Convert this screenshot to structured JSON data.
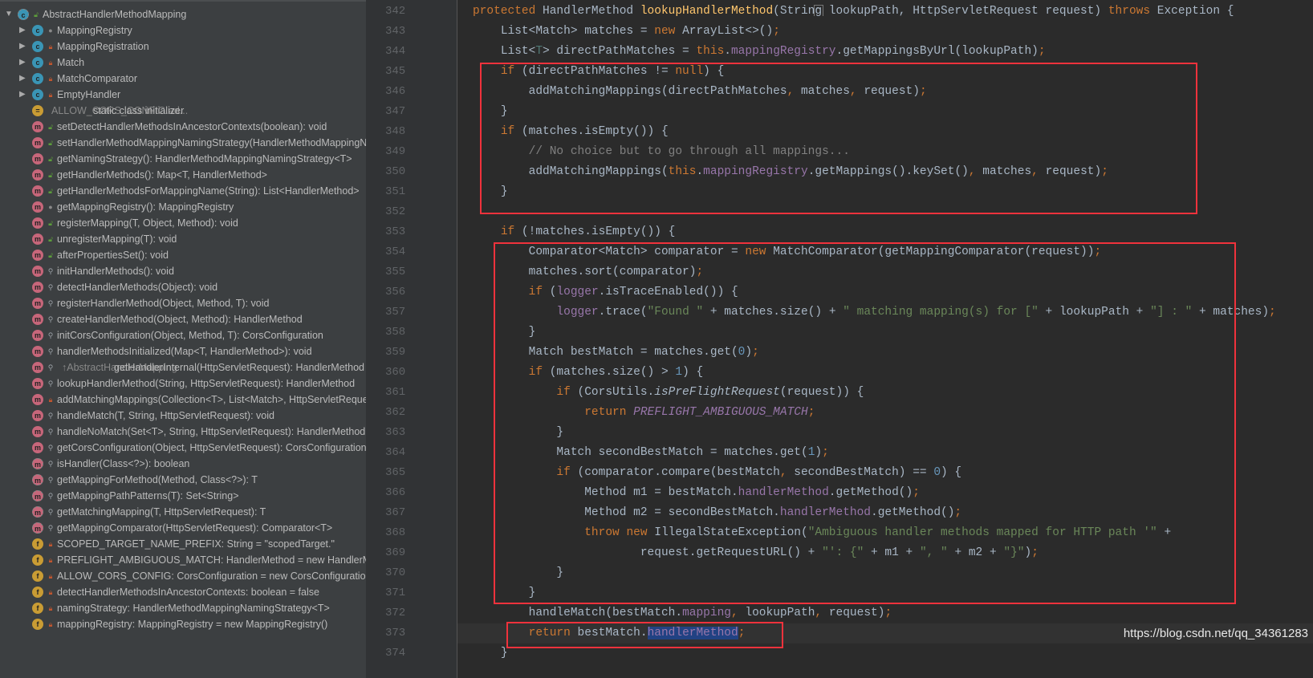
{
  "structure": {
    "items": [
      {
        "label": "AbstractHandlerMethodMapping",
        "icon": "c",
        "abstract": true,
        "vis": "public",
        "level": 0,
        "arrow": "expanded"
      },
      {
        "label": "MappingRegistry",
        "icon": "c",
        "vis": "package",
        "level": 1,
        "arrow": "collapsed"
      },
      {
        "label": "MappingRegistration",
        "icon": "c",
        "vis": "private",
        "level": 1,
        "arrow": "collapsed"
      },
      {
        "label": "Match",
        "icon": "c",
        "vis": "private",
        "level": 1,
        "arrow": "collapsed"
      },
      {
        "label": "MatchComparator",
        "icon": "c",
        "vis": "private",
        "level": 1,
        "arrow": "collapsed"
      },
      {
        "label": "EmptyHandler",
        "icon": "c",
        "vis": "private",
        "level": 1,
        "arrow": "collapsed"
      },
      {
        "label": "static class initializer",
        "hint": "ALLOW_CORS_CONFIG.ad...",
        "icon": "s",
        "vis": "",
        "level": 1
      },
      {
        "label": "setDetectHandlerMethodsInAncestorContexts(boolean): void",
        "icon": "m",
        "vis": "public",
        "level": 1
      },
      {
        "label": "setHandlerMethodMappingNamingStrategy(HandlerMethodMappingNamingStrategy<T>): void",
        "icon": "m",
        "vis": "public",
        "level": 1
      },
      {
        "label": "getNamingStrategy(): HandlerMethodMappingNamingStrategy<T>",
        "icon": "m",
        "vis": "public",
        "level": 1
      },
      {
        "label": "getHandlerMethods(): Map<T, HandlerMethod>",
        "icon": "m",
        "vis": "public",
        "level": 1
      },
      {
        "label": "getHandlerMethodsForMappingName(String): List<HandlerMethod>",
        "icon": "m",
        "vis": "public",
        "level": 1
      },
      {
        "label": "getMappingRegistry(): MappingRegistry",
        "icon": "m",
        "vis": "package",
        "level": 1
      },
      {
        "label": "registerMapping(T, Object, Method): void",
        "icon": "m",
        "vis": "public",
        "level": 1
      },
      {
        "label": "unregisterMapping(T): void",
        "icon": "m",
        "vis": "public",
        "level": 1
      },
      {
        "label": "afterPropertiesSet(): void",
        "icon": "m",
        "vis": "public",
        "level": 1
      },
      {
        "label": "initHandlerMethods(): void",
        "icon": "m",
        "vis": "protected",
        "level": 1
      },
      {
        "label": "detectHandlerMethods(Object): void",
        "icon": "m",
        "vis": "protected",
        "level": 1
      },
      {
        "label": "registerHandlerMethod(Object, Method, T): void",
        "icon": "m",
        "vis": "protected",
        "level": 1
      },
      {
        "label": "createHandlerMethod(Object, Method): HandlerMethod",
        "icon": "m",
        "vis": "protected",
        "level": 1
      },
      {
        "label": "initCorsConfiguration(Object, Method, T): CorsConfiguration",
        "icon": "m",
        "vis": "protected",
        "level": 1
      },
      {
        "label": "handlerMethodsInitialized(Map<T, HandlerMethod>): void",
        "icon": "m",
        "vis": "protected",
        "level": 1
      },
      {
        "label": "getHandlerInternal(HttpServletRequest): HandlerMethod",
        "hint": "↑AbstractHandlerMapping",
        "icon": "m",
        "vis": "protected",
        "level": 1
      },
      {
        "label": "lookupHandlerMethod(String, HttpServletRequest): HandlerMethod",
        "icon": "m",
        "vis": "protected",
        "level": 1
      },
      {
        "label": "addMatchingMappings(Collection<T>, List<Match>, HttpServletRequest): void",
        "icon": "m",
        "vis": "private",
        "level": 1
      },
      {
        "label": "handleMatch(T, String, HttpServletRequest): void",
        "icon": "m",
        "vis": "protected",
        "level": 1
      },
      {
        "label": "handleNoMatch(Set<T>, String, HttpServletRequest): HandlerMethod",
        "icon": "m",
        "vis": "protected",
        "level": 1
      },
      {
        "label": "getCorsConfiguration(Object, HttpServletRequest): CorsConfiguration",
        "icon": "m",
        "vis": "protected",
        "level": 1
      },
      {
        "label": "isHandler(Class<?>): boolean",
        "icon": "m",
        "abstract": true,
        "vis": "protected",
        "level": 1
      },
      {
        "label": "getMappingForMethod(Method, Class<?>): T",
        "icon": "m",
        "abstract": true,
        "vis": "protected",
        "level": 1
      },
      {
        "label": "getMappingPathPatterns(T): Set<String>",
        "icon": "m",
        "abstract": true,
        "vis": "protected",
        "level": 1
      },
      {
        "label": "getMatchingMapping(T, HttpServletRequest): T",
        "icon": "m",
        "abstract": true,
        "vis": "protected",
        "level": 1
      },
      {
        "label": "getMappingComparator(HttpServletRequest): Comparator<T>",
        "icon": "m",
        "abstract": true,
        "vis": "protected",
        "level": 1
      },
      {
        "label": "SCOPED_TARGET_NAME_PREFIX: String = \"scopedTarget.\"",
        "icon": "f",
        "vis": "private",
        "level": 1
      },
      {
        "label": "PREFLIGHT_AMBIGUOUS_MATCH: HandlerMethod = new HandlerMethod(...)",
        "icon": "f",
        "vis": "private",
        "level": 1
      },
      {
        "label": "ALLOW_CORS_CONFIG: CorsConfiguration = new CorsConfiguration()",
        "icon": "f",
        "vis": "private",
        "level": 1
      },
      {
        "label": "detectHandlerMethodsInAncestorContexts: boolean = false",
        "icon": "f",
        "vis": "private",
        "level": 1
      },
      {
        "label": "namingStrategy: HandlerMethodMappingNamingStrategy<T>",
        "icon": "f",
        "vis": "private",
        "level": 1
      },
      {
        "label": "mappingRegistry: MappingRegistry = new MappingRegistry()",
        "icon": "f",
        "vis": "private",
        "level": 1
      }
    ]
  },
  "editor": {
    "lines": [
      {
        "n": "342",
        "i": 0,
        "t": [
          [
            "k",
            "protected "
          ],
          [
            "p",
            "HandlerMethod "
          ],
          [
            "md",
            "lookupHandlerMethod"
          ],
          [
            "p",
            "(String lookupPath, HttpServletRequest request) "
          ],
          [
            "k",
            "throws "
          ],
          [
            "p",
            "Exception {"
          ]
        ]
      },
      {
        "n": "343",
        "i": 1,
        "t": [
          [
            "p",
            "List<Match> matches = "
          ],
          [
            "k",
            "new "
          ],
          [
            "p",
            "ArrayList<>()"
          ],
          [
            "k",
            ";"
          ]
        ]
      },
      {
        "n": "344",
        "i": 1,
        "t": [
          [
            "p",
            "List<"
          ],
          [
            "tp",
            "T"
          ],
          [
            "p",
            "> directPathMatches = "
          ],
          [
            "k",
            "this"
          ],
          [
            "p",
            "."
          ],
          [
            "fd",
            "mappingRegistry"
          ],
          [
            "p",
            ".getMappingsByUrl(lookupPath)"
          ],
          [
            "k",
            ";"
          ]
        ]
      },
      {
        "n": "345",
        "i": 1,
        "t": [
          [
            "k",
            "if "
          ],
          [
            "p",
            "(directPathMatches != "
          ],
          [
            "k",
            "null"
          ],
          [
            "p",
            ") {"
          ]
        ]
      },
      {
        "n": "346",
        "i": 2,
        "t": [
          [
            "p",
            "addMatchingMappings(directPathMatches"
          ],
          [
            "k",
            ", "
          ],
          [
            "p",
            "matches"
          ],
          [
            "k",
            ", "
          ],
          [
            "p",
            "request)"
          ],
          [
            "k",
            ";"
          ]
        ]
      },
      {
        "n": "347",
        "i": 1,
        "t": [
          [
            "p",
            "}"
          ]
        ]
      },
      {
        "n": "348",
        "i": 1,
        "t": [
          [
            "k",
            "if "
          ],
          [
            "p",
            "(matches.isEmpty()) {"
          ]
        ]
      },
      {
        "n": "349",
        "i": 2,
        "t": [
          [
            "cm",
            "// No choice but to go through all mappings..."
          ]
        ]
      },
      {
        "n": "350",
        "i": 2,
        "t": [
          [
            "p",
            "addMatchingMappings("
          ],
          [
            "k",
            "this"
          ],
          [
            "p",
            "."
          ],
          [
            "fd",
            "mappingRegistry"
          ],
          [
            "p",
            ".getMappings().keySet()"
          ],
          [
            "k",
            ", "
          ],
          [
            "p",
            "matches"
          ],
          [
            "k",
            ", "
          ],
          [
            "p",
            "request)"
          ],
          [
            "k",
            ";"
          ]
        ]
      },
      {
        "n": "351",
        "i": 1,
        "t": [
          [
            "p",
            "}"
          ]
        ]
      },
      {
        "n": "352",
        "i": 0,
        "t": []
      },
      {
        "n": "353",
        "i": 1,
        "t": [
          [
            "k",
            "if "
          ],
          [
            "p",
            "(!matches.isEmpty()) {"
          ]
        ]
      },
      {
        "n": "354",
        "i": 2,
        "t": [
          [
            "p",
            "Comparator<Match> comparator = "
          ],
          [
            "k",
            "new "
          ],
          [
            "p",
            "MatchComparator(getMappingComparator(request))"
          ],
          [
            "k",
            ";"
          ]
        ]
      },
      {
        "n": "355",
        "i": 2,
        "t": [
          [
            "p",
            "matches.sort(comparator)"
          ],
          [
            "k",
            ";"
          ]
        ]
      },
      {
        "n": "356",
        "i": 2,
        "t": [
          [
            "k",
            "if "
          ],
          [
            "p",
            "("
          ],
          [
            "fd",
            "logger"
          ],
          [
            "p",
            ".isTraceEnabled()) {"
          ]
        ]
      },
      {
        "n": "357",
        "i": 3,
        "t": [
          [
            "fd",
            "logger"
          ],
          [
            "p",
            ".trace("
          ],
          [
            "st",
            "\"Found \""
          ],
          [
            "p",
            " + matches.size() + "
          ],
          [
            "st",
            "\" matching mapping(s) for [\""
          ],
          [
            "p",
            " + lookupPath + "
          ],
          [
            "st",
            "\"] : \""
          ],
          [
            "p",
            " + matches)"
          ],
          [
            "k",
            ";"
          ]
        ]
      },
      {
        "n": "358",
        "i": 2,
        "t": [
          [
            "p",
            "}"
          ]
        ]
      },
      {
        "n": "359",
        "i": 2,
        "t": [
          [
            "p",
            "Match bestMatch = matches.get("
          ],
          [
            "nu",
            "0"
          ],
          [
            "p",
            ")"
          ],
          [
            "k",
            ";"
          ]
        ]
      },
      {
        "n": "360",
        "i": 2,
        "t": [
          [
            "k",
            "if "
          ],
          [
            "p",
            "(matches.size() > "
          ],
          [
            "nu",
            "1"
          ],
          [
            "p",
            ") {"
          ]
        ]
      },
      {
        "n": "361",
        "i": 3,
        "t": [
          [
            "k",
            "if "
          ],
          [
            "p",
            "(CorsUtils."
          ],
          [
            "sf",
            "isPreFlightRequest"
          ],
          [
            "p",
            "(request)) {"
          ]
        ]
      },
      {
        "n": "362",
        "i": 4,
        "t": [
          [
            "k",
            "return "
          ],
          [
            "it",
            "PREFLIGHT_AMBIGUOUS_MATCH"
          ],
          [
            "k",
            ";"
          ]
        ]
      },
      {
        "n": "363",
        "i": 3,
        "t": [
          [
            "p",
            "}"
          ]
        ]
      },
      {
        "n": "364",
        "i": 3,
        "t": [
          [
            "p",
            "Match secondBestMatch = matches.get("
          ],
          [
            "nu",
            "1"
          ],
          [
            "p",
            ")"
          ],
          [
            "k",
            ";"
          ]
        ]
      },
      {
        "n": "365",
        "i": 3,
        "t": [
          [
            "k",
            "if "
          ],
          [
            "p",
            "(comparator.compare(bestMatch"
          ],
          [
            "k",
            ", "
          ],
          [
            "p",
            "secondBestMatch) == "
          ],
          [
            "nu",
            "0"
          ],
          [
            "p",
            ") {"
          ]
        ]
      },
      {
        "n": "366",
        "i": 4,
        "t": [
          [
            "p",
            "Method m1 = bestMatch."
          ],
          [
            "fd",
            "handlerMethod"
          ],
          [
            "p",
            ".getMethod()"
          ],
          [
            "k",
            ";"
          ]
        ]
      },
      {
        "n": "367",
        "i": 4,
        "t": [
          [
            "p",
            "Method m2 = secondBestMatch."
          ],
          [
            "fd",
            "handlerMethod"
          ],
          [
            "p",
            ".getMethod()"
          ],
          [
            "k",
            ";"
          ]
        ]
      },
      {
        "n": "368",
        "i": 4,
        "t": [
          [
            "k",
            "throw new "
          ],
          [
            "p",
            "IllegalStateException("
          ],
          [
            "st",
            "\"Ambiguous handler methods mapped for HTTP path '\""
          ],
          [
            "p",
            " +"
          ]
        ]
      },
      {
        "n": "369",
        "i": 6,
        "t": [
          [
            "p",
            "request.getRequestURL() + "
          ],
          [
            "st",
            "\"': {\""
          ],
          [
            "p",
            " + m1 + "
          ],
          [
            "st",
            "\", \""
          ],
          [
            "p",
            " + m2 + "
          ],
          [
            "st",
            "\"}\""
          ],
          [
            "p",
            ")"
          ],
          [
            "k",
            ";"
          ]
        ]
      },
      {
        "n": "370",
        "i": 3,
        "t": [
          [
            "p",
            "}"
          ]
        ]
      },
      {
        "n": "371",
        "i": 2,
        "t": [
          [
            "p",
            "}"
          ]
        ]
      },
      {
        "n": "372",
        "i": 2,
        "t": [
          [
            "p",
            "handleMatch(bestMatch."
          ],
          [
            "fd",
            "mapping"
          ],
          [
            "k",
            ", "
          ],
          [
            "p",
            "lookupPath"
          ],
          [
            "k",
            ", "
          ],
          [
            "p",
            "request)"
          ],
          [
            "k",
            ";"
          ]
        ]
      },
      {
        "n": "373",
        "i": 2,
        "cur": true,
        "t": [
          [
            "k",
            "return "
          ],
          [
            "p",
            "bestMatch."
          ],
          [
            "sel",
            "handlerMethod"
          ],
          [
            "k",
            ";"
          ]
        ]
      },
      {
        "n": "374",
        "i": 1,
        "t": [
          [
            "p",
            "}"
          ]
        ]
      }
    ]
  },
  "watermark": "https://blog.csdn.net/qq_34361283",
  "colors": {
    "highlight_box": "#f0323c",
    "keyword": "#cc7832",
    "method_decl": "#ffc66d",
    "field": "#9876aa",
    "string": "#6a8759"
  }
}
